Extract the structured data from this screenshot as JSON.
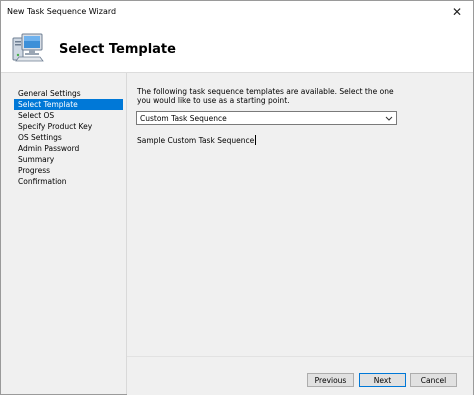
{
  "window": {
    "title": "New Task Sequence Wizard",
    "close_glyph": "✕"
  },
  "header": {
    "icon": "computer-icon",
    "page_title": "Select Template"
  },
  "nav": {
    "items": [
      {
        "label": "General Settings",
        "selected": false
      },
      {
        "label": "Select Template",
        "selected": true
      },
      {
        "label": "Select OS",
        "selected": false
      },
      {
        "label": "Specify Product Key",
        "selected": false
      },
      {
        "label": "OS Settings",
        "selected": false
      },
      {
        "label": "Admin Password",
        "selected": false
      },
      {
        "label": "Summary",
        "selected": false
      },
      {
        "label": "Progress",
        "selected": false
      },
      {
        "label": "Confirmation",
        "selected": false
      }
    ]
  },
  "content": {
    "intro": "The following task sequence templates are available.  Select the one you would like to use as a starting point.",
    "template_select": {
      "value": "Custom Task Sequence"
    },
    "description": "Sample Custom Task Sequence"
  },
  "footer": {
    "previous_label": "Previous",
    "next_label": "Next",
    "cancel_label": "Cancel"
  },
  "colors": {
    "accent": "#0078d7",
    "panel_bg": "#f0f0f0"
  }
}
